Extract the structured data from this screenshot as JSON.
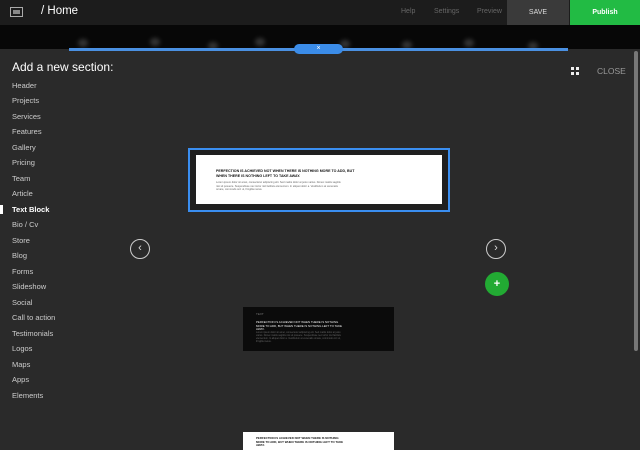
{
  "topbar": {
    "logo_icon": "logo-icon",
    "page_title": "/ Home",
    "nav": [
      "Help",
      "Settings",
      "Preview"
    ],
    "save_label": "SAVE",
    "publish_label": "Publish",
    "publish_color": "#22bb44"
  },
  "strip": {
    "close_symbol": "×",
    "accent_color": "#4a90e2"
  },
  "panel": {
    "heading": "Add a new section:",
    "grid_icon": "grid-icon",
    "close_label": "CLOSE",
    "sections": [
      "Header",
      "Projects",
      "Services",
      "Features",
      "Gallery",
      "Pricing",
      "Team",
      "Article",
      "Text Block",
      "Bio / Cv",
      "Store",
      "Blog",
      "Forms",
      "Slideshow",
      "Social",
      "Call to action",
      "Testimonials",
      "Logos",
      "Maps",
      "Apps",
      "Elements"
    ],
    "active_section": "Text Block"
  },
  "preview": {
    "headline": "PERFECTION IS ACHIEVED NOT WHEN THERE IS NOTHING MORE TO ADD, BUT WHEN THERE IS NOTHING LEFT TO TAKE AWAY.",
    "body": "Lorem ipsum dolor sit amet, consectetur adipiscing elit. Sed mattis dolor at justo varius. Donec mattis sagittis nisi sit posuere. Suspendisse nec tortor nisl facilisis elementum. In aliquet dolor a. Vestibulum at venenatis ornare, commodo orci ut, fringilla metus.",
    "prev_icon": "chevron-left-icon",
    "next_icon": "chevron-right-icon",
    "prev_symbol": "‹",
    "next_symbol": "›",
    "add_symbol": "+",
    "add_color": "#22aa33"
  },
  "thumbs": {
    "dark_label": "TEXT",
    "dark_headline": "PERFECTION IS ACHIEVED NOT WHEN THERE IS NOTHING MORE TO ADD, BUT WHEN THERE IS NOTHING LEFT TO TAKE AWAY.",
    "dark_body": "Lorem ipsum dolor sit amet, consectetur adipiscing elit. Sed mattis dolor at justo varius. Donec mattis sagittis nisi sit posuere. Suspendisse nec tortor nisl facilisis elementum. In aliquet dolor a. Vestibulum at venenatis ornare, commodo orci ut, fringilla metus.",
    "light_headline": "PERFECTION IS ACHIEVED NOT WHEN THERE IS NOTHING MORE TO ADD, BUT WHEN THERE IS NOTHING LEFT TO TAKE AWAY."
  }
}
